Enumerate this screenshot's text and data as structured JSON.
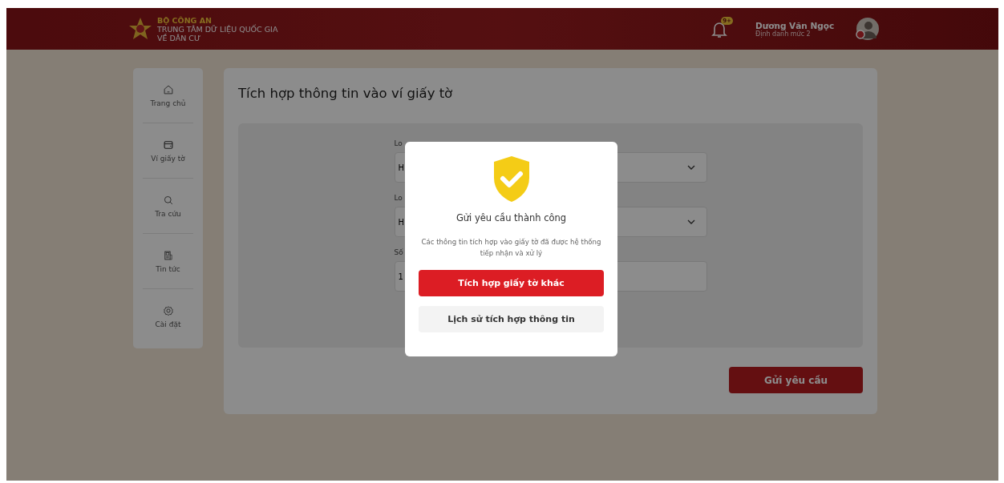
{
  "header": {
    "org": "BỘ CÔNG AN",
    "title_lines": [
      "TRUNG TÂM DỮ LIỆU QUỐC GIA",
      "VỀ DÂN CƯ"
    ],
    "notification_badge": "9+",
    "user": {
      "name": "Dương Văn Ngọc",
      "level": "Định danh mức 2"
    }
  },
  "sidebar": {
    "items": [
      {
        "label": "Trang chủ"
      },
      {
        "label": "Ví giấy tờ"
      },
      {
        "label": "Tra cứu"
      },
      {
        "label": "Tin tức"
      },
      {
        "label": "Cài đặt"
      }
    ]
  },
  "page": {
    "title": "Tích hợp thông tin vào ví giấy tờ",
    "fields": [
      {
        "kind": "select",
        "label": "Lo",
        "value": "H"
      },
      {
        "kind": "select",
        "label": "Lo",
        "value": "H"
      },
      {
        "kind": "input",
        "label": "Số",
        "value": "1"
      }
    ],
    "submit_button": "Gửi yêu cầu"
  },
  "modal": {
    "title": "Gửi yêu cầu thành công",
    "message": "Các thông tin tích hợp vào giấy tờ đã được hệ thống tiếp nhận và xử lý",
    "primary_button": "Tích hợp giấy tờ khác",
    "secondary_button": "Lịch sử tích hợp thông tin"
  }
}
